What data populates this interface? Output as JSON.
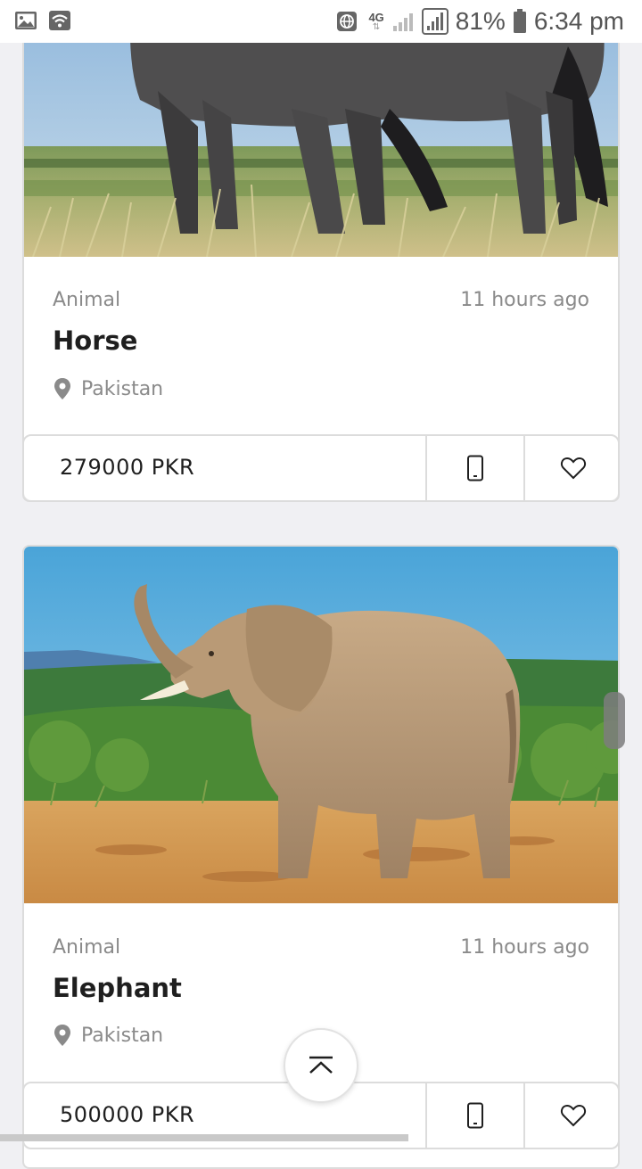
{
  "status_bar": {
    "battery_percent": "81%",
    "time": "6:34 pm",
    "network": "4G"
  },
  "listings": [
    {
      "category": "Animal",
      "time_ago": "11 hours ago",
      "title": "Horse",
      "location": "Pakistan",
      "price": "279000 PKR",
      "image_subject": "horse"
    },
    {
      "category": "Animal",
      "time_ago": "11 hours ago",
      "title": "Elephant",
      "location": "Pakistan",
      "price": "500000 PKR",
      "image_subject": "elephant"
    }
  ],
  "icons": {
    "location": "map-pin-icon",
    "phone": "mobile-phone-icon",
    "favorite": "heart-icon",
    "scroll_top": "chevron-up-icon"
  },
  "colors": {
    "background": "#f0f0f3",
    "card": "#ffffff",
    "text_primary": "#1f1f1f",
    "text_secondary": "#8a8a8a",
    "border": "#dcdcdc"
  }
}
